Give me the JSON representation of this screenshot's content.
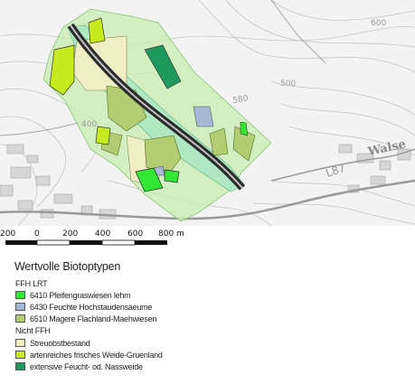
{
  "map": {
    "topo_labels": [
      "400",
      "580",
      "500",
      "600",
      "L87",
      "Walse"
    ]
  },
  "scale": {
    "ticks": [
      "200",
      "0",
      "200",
      "400",
      "600",
      "800 m"
    ]
  },
  "legend": {
    "title": "Wertvolle Biotoptypen",
    "groups": [
      {
        "label": "FFH LRT",
        "items": [
          {
            "label": "6410 Pfeifengraswiesen lehm",
            "color": "#33e833"
          },
          {
            "label": "6430 Feuchte Hochstaudensaeume",
            "color": "#a7b7d6"
          },
          {
            "label": "6510 Magere Flachland-Maehwiesen",
            "color": "#b3cd73"
          }
        ]
      },
      {
        "label": "Nicht FFH",
        "items": [
          {
            "label": "Streuobstbestand",
            "color": "#efeec4"
          },
          {
            "label": "artenreiches frisches Weide-Gruenland",
            "color": "#c6ea1e"
          },
          {
            "label": "extensive Feucht- od. Nassweide",
            "color": "#1f9a5e"
          }
        ]
      }
    ]
  }
}
